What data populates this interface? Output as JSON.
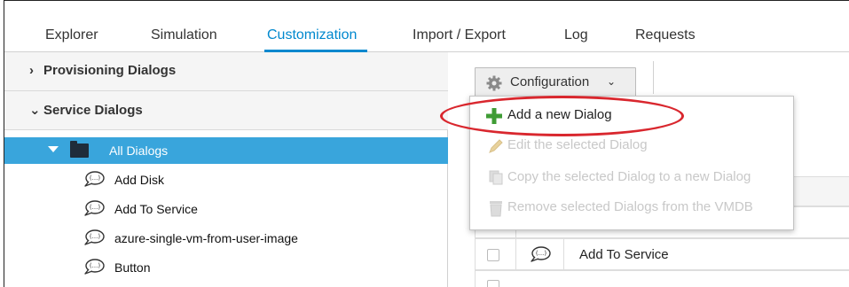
{
  "tabs": [
    {
      "label": "Explorer",
      "active": false
    },
    {
      "label": "Simulation",
      "active": false
    },
    {
      "label": "Customization",
      "active": true
    },
    {
      "label": "Import / Export",
      "active": false
    },
    {
      "label": "Log",
      "active": false
    },
    {
      "label": "Requests",
      "active": false
    }
  ],
  "accordion": {
    "provisioning": {
      "label": "Provisioning Dialogs",
      "chevron": "chevron-right-icon"
    },
    "service": {
      "label": "Service Dialogs",
      "chevron": "chevron-down-icon"
    }
  },
  "tree": {
    "root": {
      "label": "All Dialogs",
      "selected": true
    },
    "items": [
      {
        "label": "Add Disk"
      },
      {
        "label": "Add To Service"
      },
      {
        "label": "azure-single-vm-from-user-image"
      },
      {
        "label": "Button"
      }
    ]
  },
  "toolbar": {
    "configuration_label": "Configuration"
  },
  "menu": {
    "items": [
      {
        "label": "Add a new Dialog",
        "enabled": true,
        "icon": "plus-icon"
      },
      {
        "label": "Edit the selected Dialog",
        "enabled": false,
        "icon": "pencil-icon"
      },
      {
        "label": "Copy the selected Dialog to a new Dialog",
        "enabled": false,
        "icon": "copy-icon"
      },
      {
        "label": "Remove selected Dialogs from the VMDB",
        "enabled": false,
        "icon": "trash-icon"
      }
    ]
  },
  "table": {
    "rows": [
      {
        "name": "Add To Service"
      }
    ]
  },
  "colors": {
    "accent": "#0088ce",
    "selection": "#39a5dc",
    "callout": "#d9272e",
    "add_icon": "#3f9c35"
  }
}
